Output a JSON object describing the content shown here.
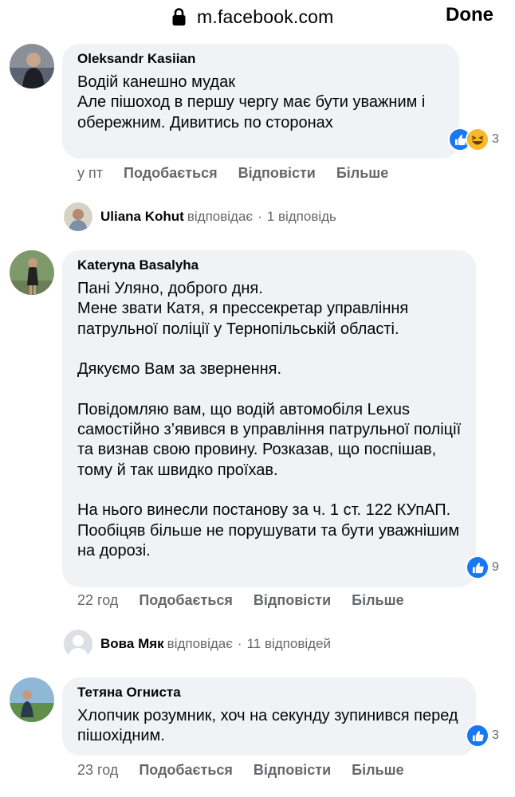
{
  "browser": {
    "url": "m.facebook.com",
    "done_label": "Done"
  },
  "actions": {
    "like": "Подобається",
    "reply": "Відповісти",
    "more": "Більше"
  },
  "comments": [
    {
      "author": "Oleksandr Kasiian",
      "text": "Водій канешно мудак\nАле пішоход в першу чергу має бути уважним і обережним. Дивитись по сторонах",
      "time": "у пт",
      "reactions": {
        "icons": [
          "like-icon",
          "haha-icon"
        ],
        "count": "3"
      },
      "reply_summary": {
        "name": "Uliana Kohut",
        "verb": "відповідає",
        "count": "1 відповідь"
      }
    },
    {
      "author": "Kateryna Basalyha",
      "text": "Пані Уляно, доброго дня.\nМене звати Катя, я прессекретар управління патрульної поліції у Тернопільській області.\n\nДякуємо Вам за звернення.\n\nПовідомляю вам, що водій автомобіля Lexus самостійно з’явився в управління патрульної поліції та визнав свою провину. Розказав, що поспішав, тому й так швидко проїхав.\n\nНа нього винесли постанову за ч. 1 ст. 122 КУпАП.\nПообіцяв більше не порушувати та бути уважнішим на дорозі.",
      "time": "22 год",
      "reactions": {
        "icons": [
          "like-icon"
        ],
        "count": "9"
      },
      "reply_summary": {
        "name": "Вова Мяк",
        "verb": "відповідає",
        "count": "11 відповідей"
      }
    },
    {
      "author": "Тетяна Огниста",
      "text": "Хлопчик розумник, хоч на секунду зупинився перед пішохідним.",
      "time": "23 год",
      "reactions": {
        "icons": [
          "like-icon"
        ],
        "count": "3"
      }
    }
  ],
  "colors": {
    "bubble": "#f0f2f5",
    "like": "#1877f2",
    "muted": "#65676b",
    "text": "#050505"
  }
}
